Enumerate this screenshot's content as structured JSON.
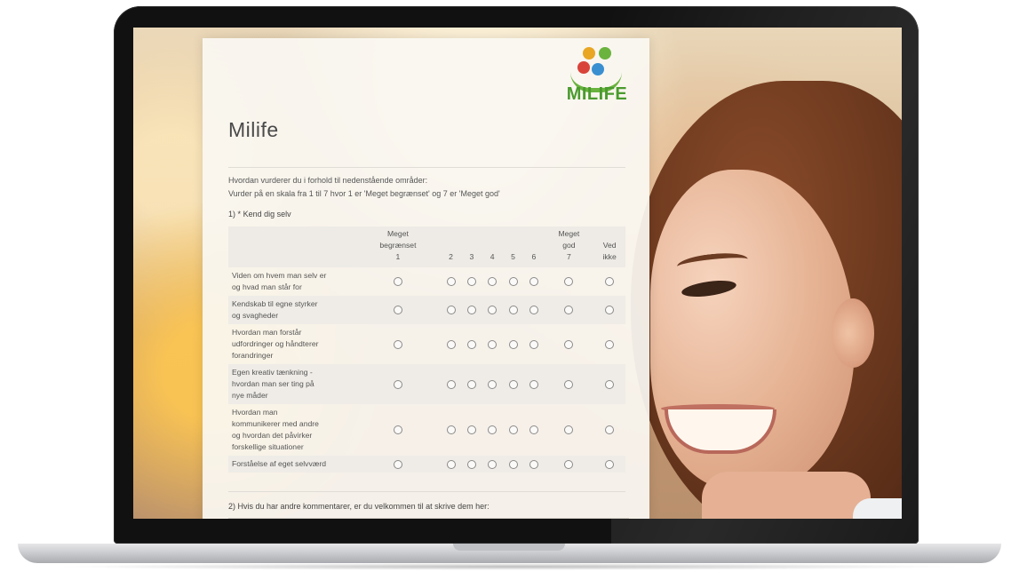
{
  "brand": {
    "logo_text": "MILIFE",
    "logo_colors": [
      "#e8a623",
      "#6ab33e",
      "#d9443a",
      "#3a8fd1",
      "#4a9b2e"
    ]
  },
  "form": {
    "title": "Milife",
    "intro_line1": "Hvordan vurderer du i forhold til nedenstående områder:",
    "intro_line2": "Vurder på en skala fra 1 til 7 hvor 1 er 'Meget begrænset' og 7 er 'Meget god'",
    "question1": {
      "number": "1)",
      "required_mark": "*",
      "label": "Kend dig selv",
      "columns": [
        {
          "line1": "Meget",
          "line2": "begrænset",
          "line3": "1"
        },
        {
          "line1": "",
          "line2": "",
          "line3": "2"
        },
        {
          "line1": "",
          "line2": "",
          "line3": "3"
        },
        {
          "line1": "",
          "line2": "",
          "line3": "4"
        },
        {
          "line1": "",
          "line2": "",
          "line3": "5"
        },
        {
          "line1": "",
          "line2": "",
          "line3": "6"
        },
        {
          "line1": "Meget",
          "line2": "god",
          "line3": "7"
        },
        {
          "line1": "",
          "line2": "Ved",
          "line3": "ikke"
        }
      ],
      "rows": [
        {
          "label_lines": [
            "Viden om hvem man selv er",
            "og hvad man står for"
          ]
        },
        {
          "label_lines": [
            "Kendskab til egne styrker",
            "og svagheder"
          ]
        },
        {
          "label_lines": [
            "Hvordan man forstår",
            "udfordringer og håndterer",
            "forandringer"
          ]
        },
        {
          "label_lines": [
            "Egen kreativ tænkning -",
            "hvordan man ser ting på",
            "nye måder"
          ]
        },
        {
          "label_lines": [
            "Hvordan man",
            "kommunikerer med andre",
            "og hvordan det påvirker",
            "forskellige situationer"
          ]
        },
        {
          "label_lines": [
            "Forståelse af eget selvværd"
          ]
        }
      ]
    },
    "question2": {
      "label": "2) Hvis du har andre kommentarer, er du velkommen til at skrive dem her:",
      "value": ""
    }
  }
}
